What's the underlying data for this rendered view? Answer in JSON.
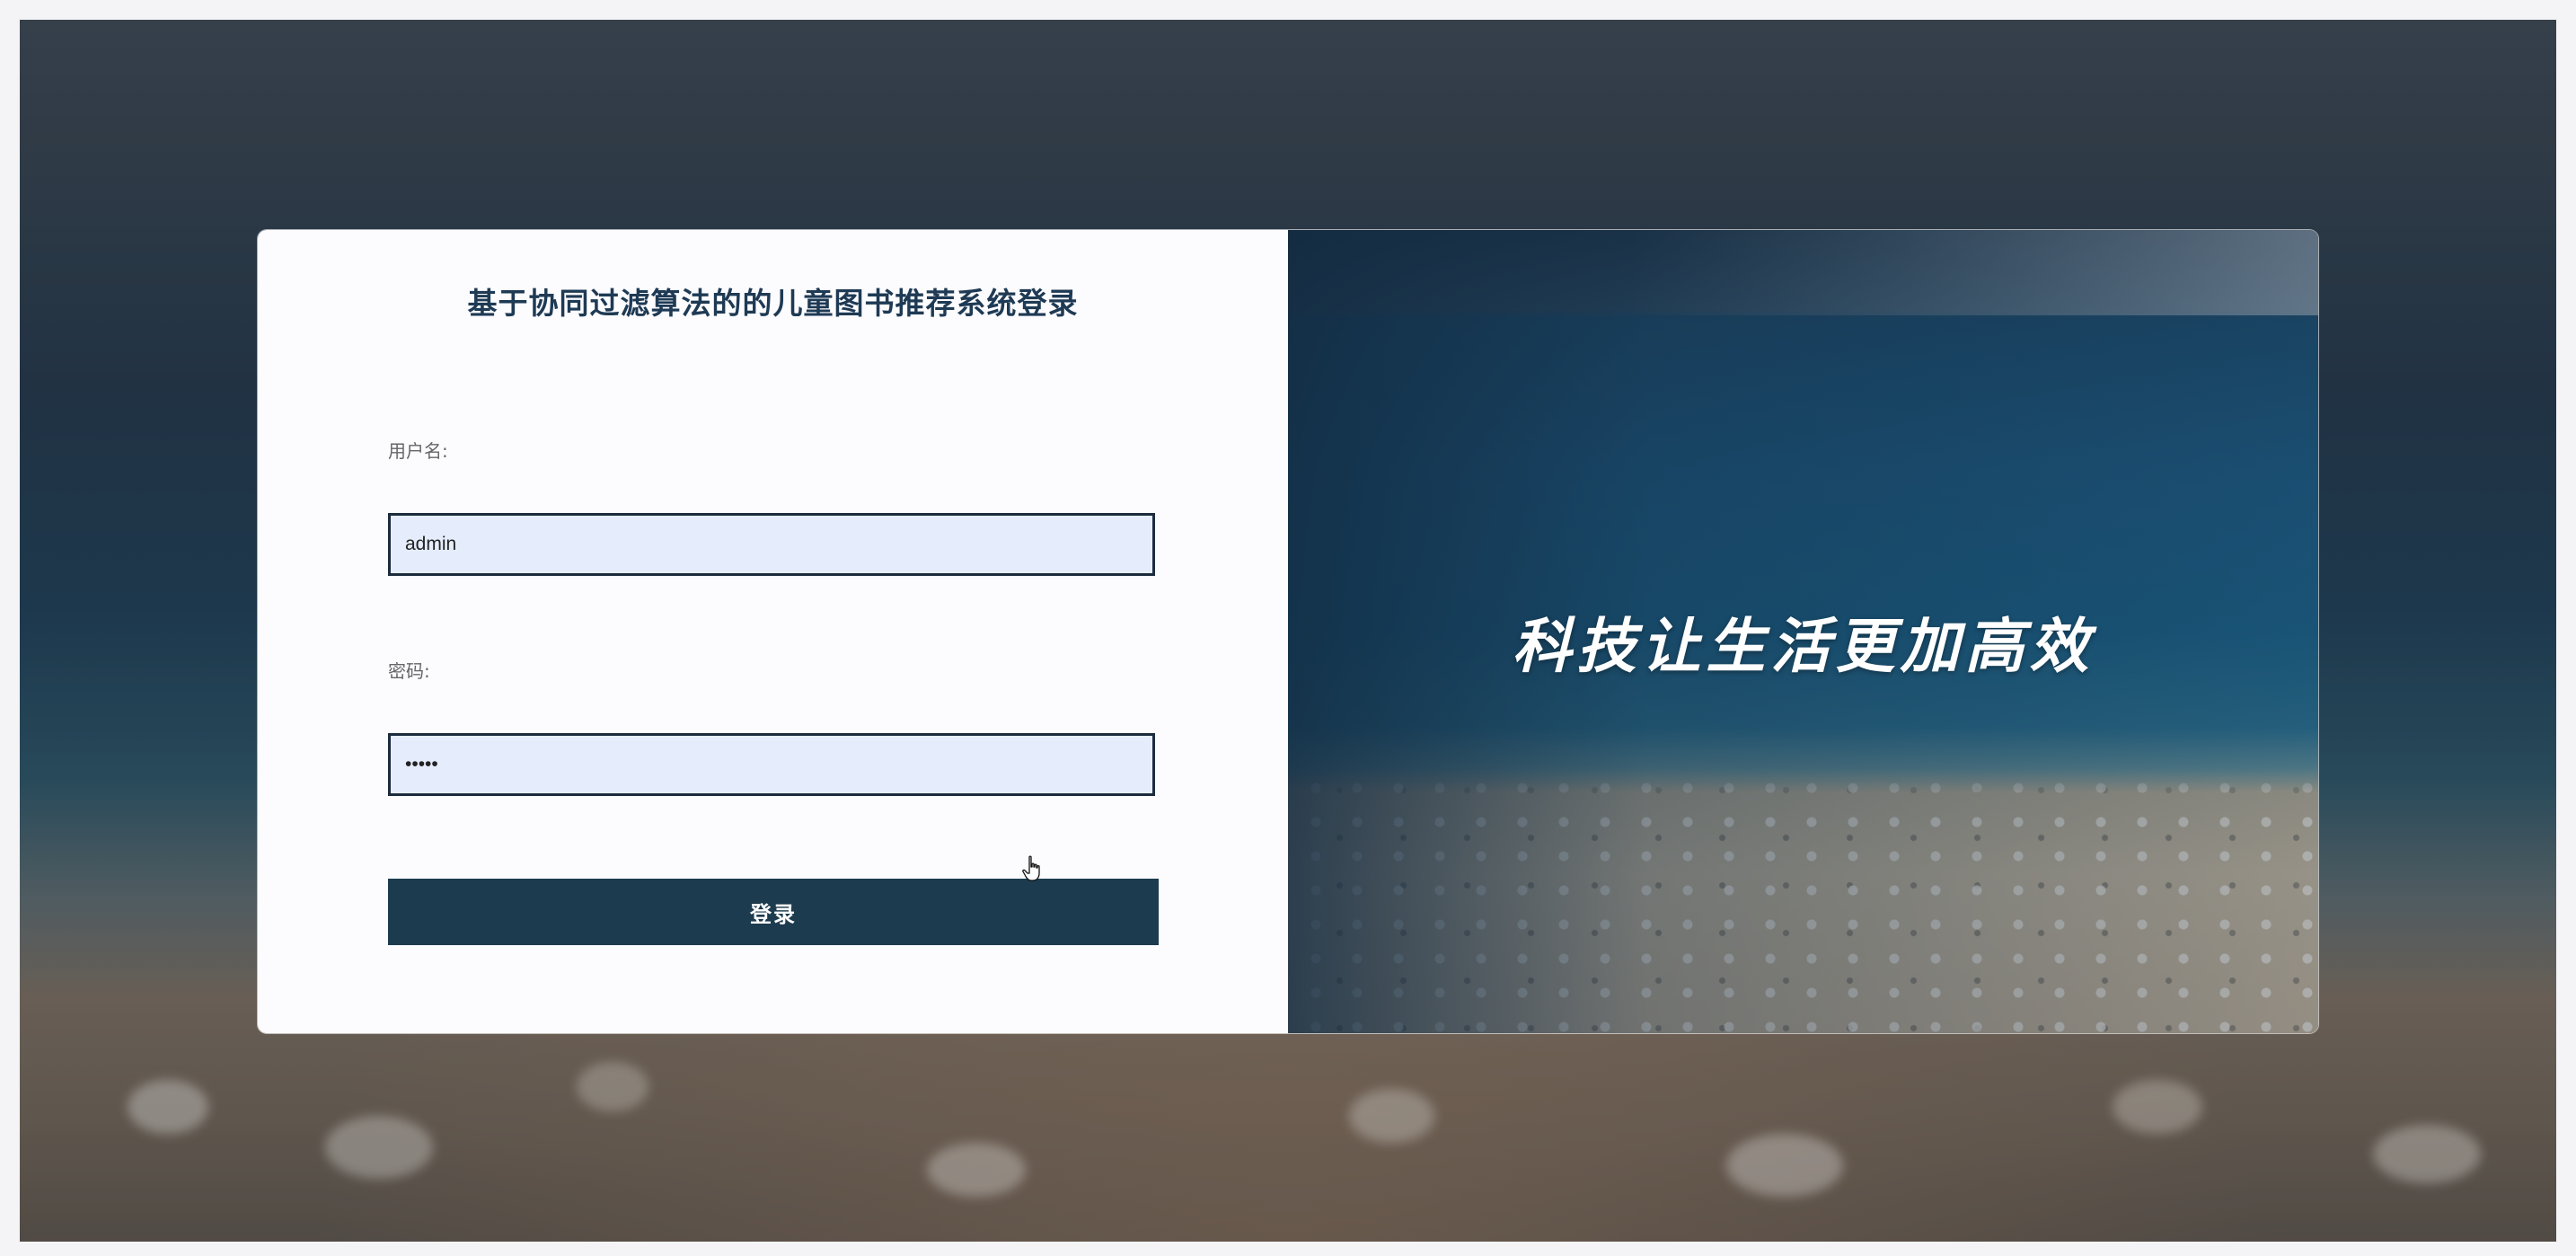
{
  "login": {
    "title": "基于协同过滤算法的的儿童图书推荐系统登录",
    "username_label": "用户名:",
    "username_value": "admin",
    "password_label": "密码:",
    "password_value": "•••••",
    "submit_label": "登录"
  },
  "banner": {
    "slogan": "科技让生活更加高效"
  },
  "colors": {
    "title": "#1e3a54",
    "input_bg": "#e5edfd",
    "input_border": "#1b2c3d",
    "button_bg": "#1c3b4f",
    "button_text": "#ffffff",
    "panel_bg": "#fcfbfe"
  },
  "icons": {
    "cursor": "hand-pointer-icon"
  }
}
